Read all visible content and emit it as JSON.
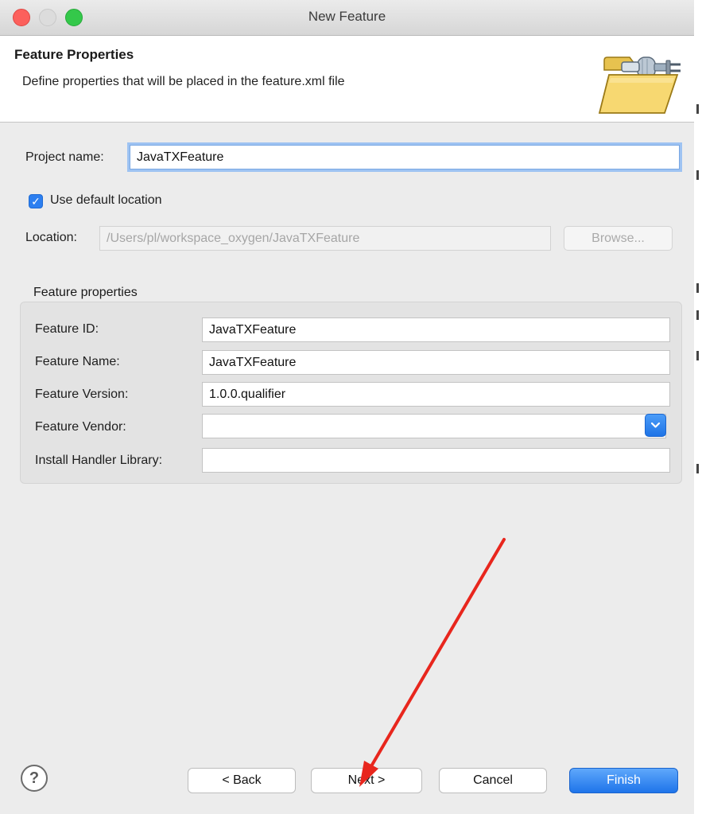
{
  "window": {
    "title": "New Feature"
  },
  "header": {
    "title": "Feature Properties",
    "description": "Define properties that will be placed in the feature.xml file",
    "icon": "folder-plug-icon"
  },
  "project": {
    "name_label": "Project name:",
    "name_value": "JavaTXFeature",
    "use_default_label": "Use default location",
    "use_default_checked": true,
    "location_label": "Location:",
    "location_value": "/Users/pl/workspace_oxygen/JavaTXFeature",
    "browse_label": "Browse..."
  },
  "feature_props": {
    "group_title": "Feature properties",
    "fields": [
      {
        "label": "Feature ID:",
        "value": "JavaTXFeature"
      },
      {
        "label": "Feature Name:",
        "value": "JavaTXFeature"
      },
      {
        "label": "Feature Version:",
        "value": "1.0.0.qualifier"
      },
      {
        "label": "Feature Vendor:",
        "value": ""
      },
      {
        "label": "Install Handler Library:",
        "value": ""
      }
    ]
  },
  "footer": {
    "help_label": "?",
    "back_label": "< Back",
    "next_label": "Next >",
    "cancel_label": "Cancel",
    "finish_label": "Finish"
  },
  "colors": {
    "accent": "#1e74ea",
    "annotation_arrow": "#e8261d",
    "traffic_close": "#fc605c",
    "traffic_max": "#34c84a"
  }
}
